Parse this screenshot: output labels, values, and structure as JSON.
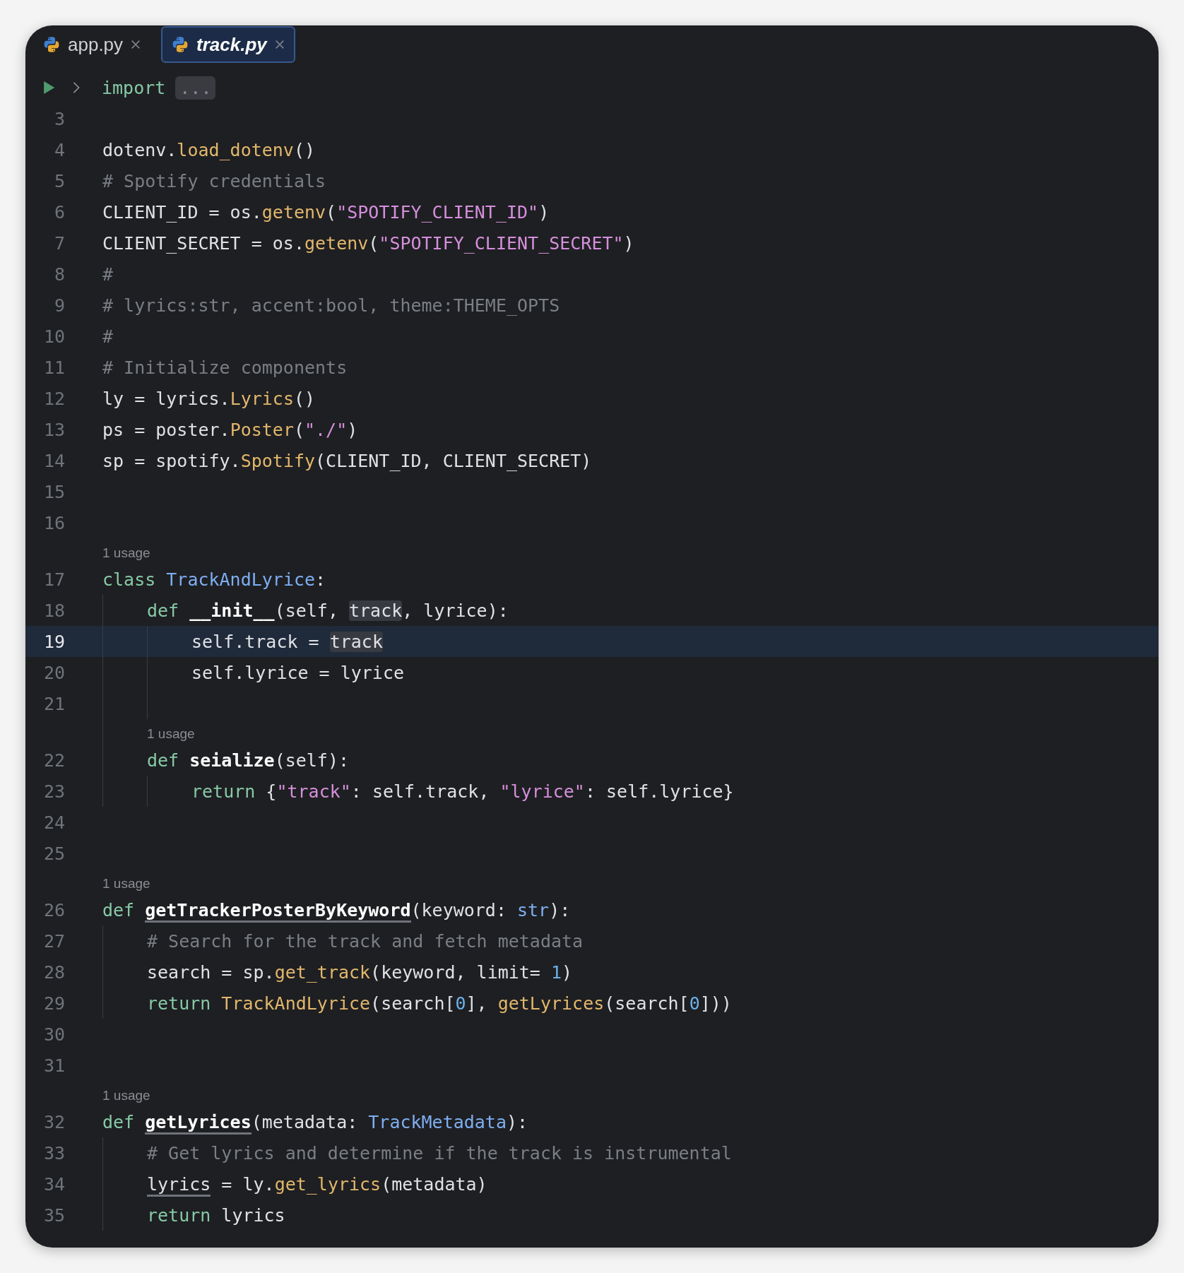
{
  "tabs": [
    {
      "label": "app.py",
      "selected": false,
      "preview": false
    },
    {
      "label": "track.py",
      "selected": true,
      "preview": true
    }
  ],
  "fold": {
    "tokens": [
      {
        "text": "import",
        "kind": "keyword"
      }
    ],
    "folded": "..."
  },
  "lines": [
    {
      "kind": "code",
      "number": "3",
      "current": false
    },
    {
      "kind": "code",
      "number": "4",
      "current": false,
      "tokens": [
        {
          "text": "dotenv.",
          "kind": "plain"
        },
        {
          "text": "load_dotenv",
          "kind": "function"
        },
        {
          "text": "()",
          "kind": "plain"
        }
      ]
    },
    {
      "kind": "code",
      "number": "5",
      "current": false,
      "tokens": [
        {
          "text": "# Spotify credentials",
          "kind": "comment"
        }
      ]
    },
    {
      "kind": "code",
      "number": "6",
      "current": false,
      "tokens": [
        {
          "text": "CLIENT_ID = os.",
          "kind": "plain"
        },
        {
          "text": "getenv",
          "kind": "function"
        },
        {
          "text": "(",
          "kind": "plain"
        },
        {
          "text": "\"SPOTIFY_CLIENT_ID\"",
          "kind": "string"
        },
        {
          "text": ")",
          "kind": "plain"
        }
      ]
    },
    {
      "kind": "code",
      "number": "7",
      "current": false,
      "tokens": [
        {
          "text": "CLIENT_SECRET = os.",
          "kind": "plain"
        },
        {
          "text": "getenv",
          "kind": "function"
        },
        {
          "text": "(",
          "kind": "plain"
        },
        {
          "text": "\"SPOTIFY_CLIENT_SECRET\"",
          "kind": "string"
        },
        {
          "text": ")",
          "kind": "plain"
        }
      ]
    },
    {
      "kind": "code",
      "number": "8",
      "current": false,
      "tokens": [
        {
          "text": "#",
          "kind": "comment"
        }
      ]
    },
    {
      "kind": "code",
      "number": "9",
      "current": false,
      "tokens": [
        {
          "text": "# lyrics:str, accent:bool, theme:THEME_OPTS",
          "kind": "comment"
        }
      ]
    },
    {
      "kind": "code",
      "number": "10",
      "current": false,
      "tokens": [
        {
          "text": "#",
          "kind": "comment"
        }
      ]
    },
    {
      "kind": "code",
      "number": "11",
      "current": false,
      "tokens": [
        {
          "text": "# Initialize components",
          "kind": "comment"
        }
      ]
    },
    {
      "kind": "code",
      "number": "12",
      "current": false,
      "tokens": [
        {
          "text": "ly = lyrics.",
          "kind": "plain"
        },
        {
          "text": "Lyrics",
          "kind": "function"
        },
        {
          "text": "()",
          "kind": "plain"
        }
      ]
    },
    {
      "kind": "code",
      "number": "13",
      "current": false,
      "tokens": [
        {
          "text": "ps = poster.",
          "kind": "plain"
        },
        {
          "text": "Poster",
          "kind": "function"
        },
        {
          "text": "(",
          "kind": "plain"
        },
        {
          "text": "\"./\"",
          "kind": "string"
        },
        {
          "text": ")",
          "kind": "plain"
        }
      ]
    },
    {
      "kind": "code",
      "number": "14",
      "current": false,
      "tokens": [
        {
          "text": "sp = spotify.",
          "kind": "plain"
        },
        {
          "text": "Spotify",
          "kind": "function"
        },
        {
          "text": "(CLIENT_ID, CLIENT_SECRET)",
          "kind": "plain"
        }
      ]
    },
    {
      "kind": "code",
      "number": "15",
      "current": false
    },
    {
      "kind": "code",
      "number": "16",
      "current": false
    },
    {
      "kind": "hint",
      "text": "1 usage"
    },
    {
      "kind": "code",
      "number": "17",
      "current": false,
      "tokens": [
        {
          "text": "class",
          "kind": "keyword"
        },
        {
          "text": "TrackAndLyrice",
          "kind": "class"
        },
        {
          "text": ":",
          "kind": "plain"
        }
      ],
      "children": [
        {
          "kind": "code",
          "number": "18",
          "current": false,
          "tokens": [
            {
              "text": "def",
              "kind": "keyword"
            },
            {
              "text": "__init__",
              "kind": "definition"
            },
            {
              "text": "(self,",
              "kind": "plain"
            },
            {
              "text": "track",
              "kind": "occurrence"
            },
            {
              "text": ", lyrice):",
              "kind": "plain"
            }
          ],
          "children": [
            {
              "kind": "code",
              "number": "19",
              "current": true,
              "tokens": [
                {
                  "text": "self.track =",
                  "kind": "plain"
                },
                {
                  "text": "track",
                  "kind": "occurrence"
                }
              ]
            },
            {
              "kind": "code",
              "number": "20",
              "current": false,
              "tokens": [
                {
                  "text": "self.lyrice = lyrice",
                  "kind": "plain"
                }
              ]
            },
            {
              "kind": "code",
              "number": "21",
              "current": false
            }
          ]
        },
        {
          "kind": "hint",
          "text": "1 usage"
        },
        {
          "kind": "code",
          "number": "22",
          "current": false,
          "tokens": [
            {
              "text": "def",
              "kind": "keyword"
            },
            {
              "text": "seialize",
              "kind": "definition"
            },
            {
              "text": "(self):",
              "kind": "plain"
            }
          ],
          "children": [
            {
              "kind": "code",
              "number": "23",
              "current": false,
              "tokens": [
                {
                  "text": "return",
                  "kind": "keyword"
                },
                {
                  "text": "{",
                  "kind": "plain"
                },
                {
                  "text": "\"track\"",
                  "kind": "string"
                },
                {
                  "text": ": self.track,",
                  "kind": "plain"
                },
                {
                  "text": "\"lyrice\"",
                  "kind": "string"
                },
                {
                  "text": ": self.lyrice}",
                  "kind": "plain"
                }
              ]
            }
          ]
        }
      ]
    },
    {
      "kind": "code",
      "number": "24",
      "current": false
    },
    {
      "kind": "code",
      "number": "25",
      "current": false
    },
    {
      "kind": "hint",
      "text": "1 usage"
    },
    {
      "kind": "code",
      "number": "26",
      "current": false,
      "tokens": [
        {
          "text": "def",
          "kind": "keyword"
        },
        {
          "text": "getTrackerPosterByKeyword",
          "kind": "definition-used"
        },
        {
          "text": "(keyword:",
          "kind": "plain"
        },
        {
          "text": "str",
          "kind": "class"
        },
        {
          "text": "):",
          "kind": "plain"
        }
      ],
      "children": [
        {
          "kind": "code",
          "number": "27",
          "current": false,
          "tokens": [
            {
              "text": "# Search for the track and fetch metadata",
              "kind": "comment"
            }
          ]
        },
        {
          "kind": "code",
          "number": "28",
          "current": false,
          "tokens": [
            {
              "text": "search = sp.",
              "kind": "plain"
            },
            {
              "text": "get_track",
              "kind": "function"
            },
            {
              "text": "(keyword, limit=",
              "kind": "plain"
            },
            {
              "text": "1",
              "kind": "number"
            },
            {
              "text": ")",
              "kind": "plain"
            }
          ]
        },
        {
          "kind": "code",
          "number": "29",
          "current": false,
          "tokens": [
            {
              "text": "return",
              "kind": "keyword"
            },
            {
              "text": "TrackAndLyrice",
              "kind": "function"
            },
            {
              "text": "(search[",
              "kind": "plain"
            },
            {
              "text": "0",
              "kind": "number"
            },
            {
              "text": "],",
              "kind": "plain"
            },
            {
              "text": "getLyrices",
              "kind": "function"
            },
            {
              "text": "(search[",
              "kind": "plain"
            },
            {
              "text": "0",
              "kind": "number"
            },
            {
              "text": "]))",
              "kind": "plain"
            }
          ]
        }
      ]
    },
    {
      "kind": "code",
      "number": "30",
      "current": false
    },
    {
      "kind": "code",
      "number": "31",
      "current": false
    },
    {
      "kind": "hint",
      "text": "1 usage"
    },
    {
      "kind": "code",
      "number": "32",
      "current": false,
      "tokens": [
        {
          "text": "def",
          "kind": "keyword"
        },
        {
          "text": "getLyrices",
          "kind": "definition-used"
        },
        {
          "text": "(metadata:",
          "kind": "plain"
        },
        {
          "text": "TrackMetadata",
          "kind": "class"
        },
        {
          "text": "):",
          "kind": "plain"
        }
      ],
      "children": [
        {
          "kind": "code",
          "number": "33",
          "current": false,
          "tokens": [
            {
              "text": "# Get lyrics and determine if the track is instrumental",
              "kind": "comment"
            }
          ]
        },
        {
          "kind": "code",
          "number": "34",
          "current": false,
          "tokens": [
            {
              "text": "lyrics",
              "kind": "variable-used"
            },
            {
              "text": "= ly.",
              "kind": "plain"
            },
            {
              "text": "get_lyrics",
              "kind": "function"
            },
            {
              "text": "(metadata)",
              "kind": "plain"
            }
          ]
        },
        {
          "kind": "code",
          "number": "35",
          "current": false,
          "tokens": [
            {
              "text": "return",
              "kind": "keyword"
            },
            {
              "text": "lyrics",
              "kind": "plain"
            }
          ]
        }
      ]
    }
  ]
}
